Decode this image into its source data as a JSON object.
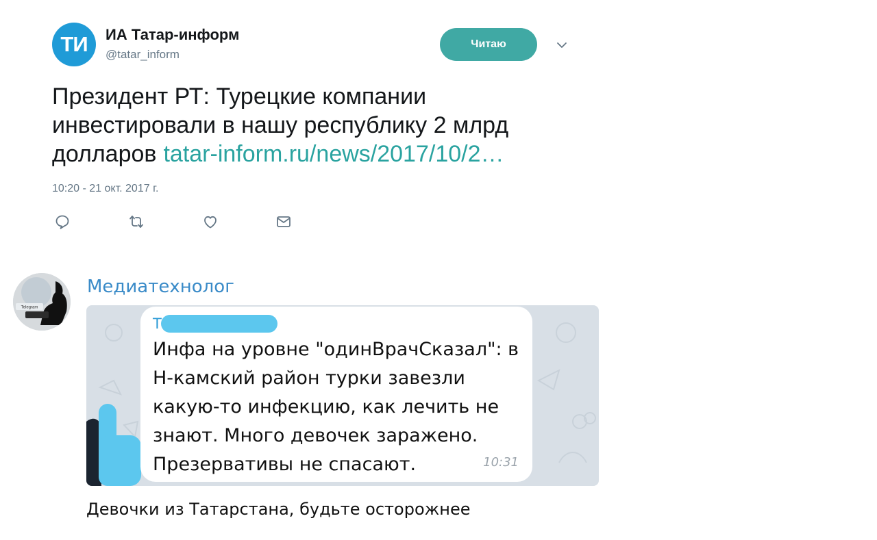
{
  "tweet": {
    "avatar_text": "ТИ",
    "author_name": "ИА Татар-информ",
    "author_handle": "@tatar_inform",
    "follow_label": "Читаю",
    "text": "Президент РТ:  Турецкие компании инвестировали в нашу республику 2 млрд долларов",
    "link": "tatar-inform.ru/news/2017/10/2…",
    "timestamp": "10:20 - 21 окт. 2017 г.",
    "actions": [
      "reply-icon",
      "retweet-icon",
      "like-icon",
      "message-icon"
    ],
    "colors": {
      "accent": "#40a9a4",
      "avatar": "#1f9bd7",
      "link": "#2aa3a0"
    }
  },
  "telegram": {
    "channel_name": "Медиатехнолог",
    "avatar_label": "Telegram",
    "forwarded": {
      "sender_visible": "Т",
      "text": "Инфа на уровне \"одинВрачСказал\": в Н-камский район турки завезли какую-то инфекцию, как лечить не знают. Много девочек заражено. Презервативы не спасают.",
      "time": "10:31"
    },
    "caption": "Девочки из Татарстана, будьте осторожнее",
    "colors": {
      "name": "#3a8bc8",
      "redaction": "#5cc7ee"
    }
  }
}
